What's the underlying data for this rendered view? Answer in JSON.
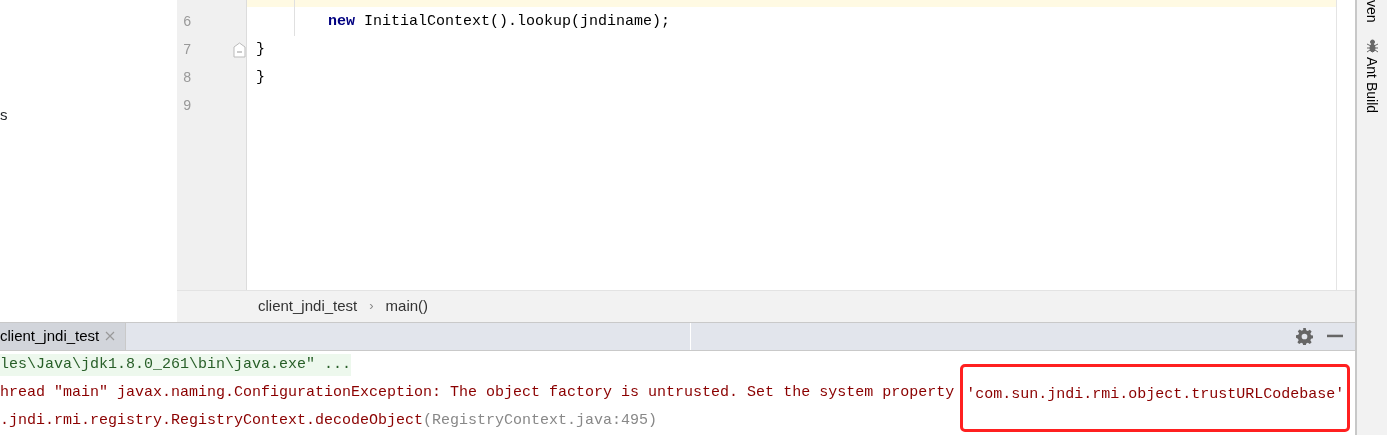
{
  "left_panel": {
    "text": "s"
  },
  "editor": {
    "lines": [
      {
        "number": "6",
        "kind": "statement",
        "tokens": [
          {
            "text": "new",
            "kind": "keyword"
          },
          {
            "text": " InitialContext().lookup(jndiname);",
            "kind": "plain"
          }
        ],
        "fold": false
      },
      {
        "number": "7",
        "kind": "brace",
        "tokens": [
          {
            "text": "}",
            "kind": "plain"
          }
        ],
        "fold": true
      },
      {
        "number": "8",
        "kind": "brace",
        "tokens": [
          {
            "text": "}",
            "kind": "plain"
          }
        ],
        "fold": false
      },
      {
        "number": "9",
        "fold": false
      }
    ],
    "breadcrumbs": [
      {
        "kind": "item",
        "text": "client_jndi_test"
      },
      {
        "kind": "separator",
        "text": "›"
      },
      {
        "kind": "item",
        "text": "main()"
      }
    ]
  },
  "right_toolbar": [
    {
      "label": "ven",
      "kind": "plain"
    },
    {
      "label": "Ant Build",
      "kind": "ant"
    }
  ],
  "run_panel": {
    "tabs": [
      {
        "label": "client_jndi_test",
        "selected": true
      }
    ],
    "console": [
      {
        "kind": "command",
        "segments": [
          {
            "text": "les\\Java\\jdk1.8.0_261\\bin\\java.exe\" ...",
            "kind": "text"
          }
        ]
      },
      {
        "kind": "error",
        "segments": [
          {
            "text": "hread \"main\" javax.naming.ConfigurationException: The object factory is untrusted. Set the system property",
            "kind": "text"
          },
          {
            "text": "'com.sun.jndi.rmi.object.trustURLCodebase'",
            "kind": "annotated"
          }
        ]
      },
      {
        "kind": "error",
        "segments": [
          {
            "text": ".jndi.rmi.registry.RegistryContext.decodeObject",
            "kind": "text"
          },
          {
            "text": "(RegistryContext.java:495)",
            "kind": "link"
          }
        ]
      }
    ]
  }
}
